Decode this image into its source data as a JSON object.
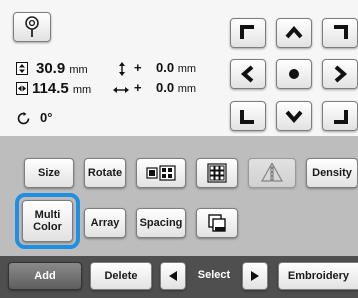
{
  "toolbar": {
    "pin_icon": "pin-icon"
  },
  "measurements": {
    "height": {
      "value": "30.9",
      "unit": "mm"
    },
    "width": {
      "value": "114.5",
      "unit": "mm"
    },
    "vertical_offset": {
      "sign": "+",
      "value": "0.0",
      "unit": "mm"
    },
    "horizontal_offset": {
      "sign": "+",
      "value": "0.0",
      "unit": "mm"
    },
    "rotation": {
      "value": "0°"
    }
  },
  "arrows": [
    "up-left",
    "up",
    "up-right",
    "left",
    "center",
    "right",
    "down-left",
    "down",
    "down-right"
  ],
  "tools": {
    "size_label": "Size",
    "rotate_label": "Rotate",
    "density_label": "Density",
    "multi_color_label_line1": "Multi",
    "multi_color_label_line2": "Color",
    "array_label": "Array",
    "spacing_label": "Spacing"
  },
  "bottom_bar": {
    "add_label": "Add",
    "delete_label": "Delete",
    "select_label": "Select",
    "embroidery_label": "Embroidery"
  },
  "colors": {
    "highlight": "#1e8fe3",
    "bottom_bar": "#4f4f4f",
    "tool_panel": "#bdbdbd"
  }
}
